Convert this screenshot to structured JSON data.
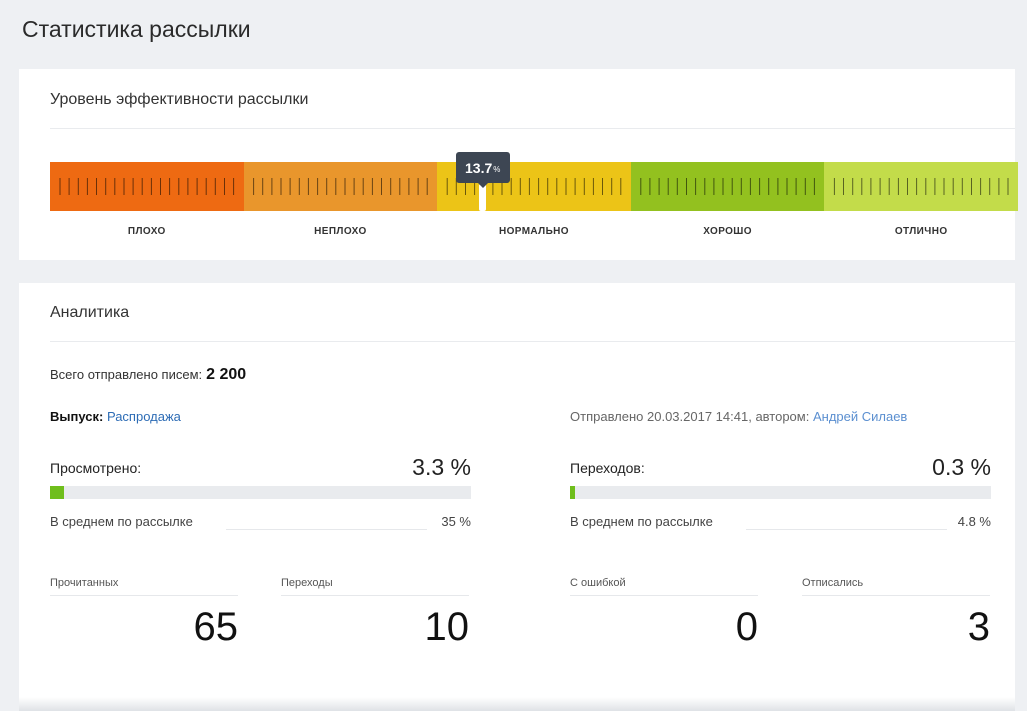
{
  "page": {
    "title": "Статистика рассылки"
  },
  "efficiency": {
    "title": "Уровень эффективности рассылки",
    "value_text": "13.7",
    "value_unit": "%",
    "marker_position_fraction": 0.447,
    "levels": [
      {
        "label": "ПЛОХО",
        "color": "#ee6a12"
      },
      {
        "label": "НЕПЛОХО",
        "color": "#e9962c"
      },
      {
        "label": "НОРМАЛЬНО",
        "color": "#ecc417"
      },
      {
        "label": "ХОРОШО",
        "color": "#93c11f"
      },
      {
        "label": "ОТЛИЧНО",
        "color": "#c3dc4a"
      }
    ]
  },
  "analytics": {
    "title": "Аналитика",
    "total_label": "Всего отправлено писем:",
    "total_value": "2 200",
    "issue_label": "Выпуск:",
    "issue_name": "Распродажа",
    "sent_text": "Отправлено 20.03.2017 14:41, автором:",
    "author": "Андрей Силаев",
    "viewed": {
      "label": "Просмотрено:",
      "value": "3.3 %",
      "fill_percent": 3.3,
      "avg_label": "В среднем по рассылке",
      "avg_value": "35 %"
    },
    "clicks": {
      "label": "Переходов:",
      "value": "0.3 %",
      "fill_percent": 1.2,
      "avg_label": "В среднем по рассылке",
      "avg_value": "4.8 %"
    },
    "stats": [
      {
        "label": "Прочитанных",
        "value": "65"
      },
      {
        "label": "Переходы",
        "value": "10"
      },
      {
        "label": "С ошибкой",
        "value": "0"
      },
      {
        "label": "Отписались",
        "value": "3"
      }
    ],
    "bar_color": "#6fbe1c"
  }
}
